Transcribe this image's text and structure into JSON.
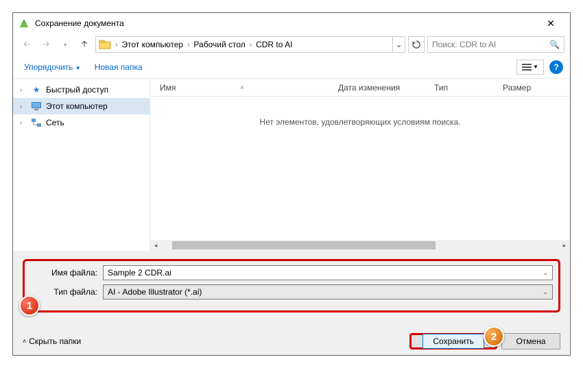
{
  "title": "Сохранение документа",
  "breadcrumb": {
    "root": "Этот компьютер",
    "desktop": "Рабочий стол",
    "folder": "CDR to AI"
  },
  "search": {
    "placeholder": "Поиск: CDR to AI"
  },
  "toolbar": {
    "organize": "Упорядочить",
    "new_folder": "Новая папка"
  },
  "sidebar": {
    "quick_access": "Быстрый доступ",
    "this_pc": "Этот компьютер",
    "network": "Сеть"
  },
  "columns": {
    "name": "Имя",
    "date": "Дата изменения",
    "type": "Тип",
    "size": "Размер"
  },
  "empty_message": "Нет элементов, удовлетворяющих условиям поиска.",
  "form": {
    "filename_label": "Имя файла:",
    "filename_value": "Sample 2 CDR.ai",
    "filetype_label": "Тип файла:",
    "filetype_value": "AI - Adobe Illustrator (*.ai)"
  },
  "footer": {
    "hide_folders": "Скрыть папки",
    "save": "Сохранить",
    "cancel": "Отмена"
  },
  "callouts": {
    "one": "1",
    "two": "2"
  }
}
